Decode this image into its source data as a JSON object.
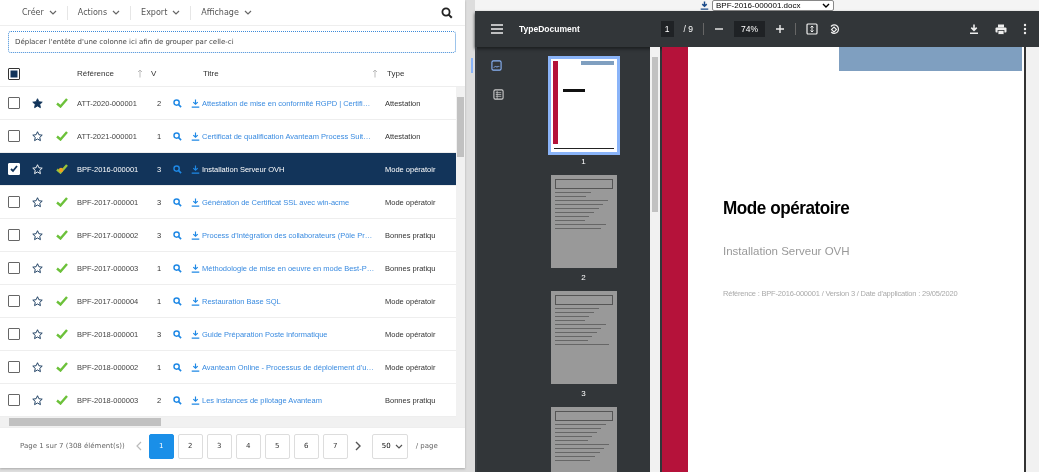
{
  "toolbar": {
    "menus": [
      {
        "label": "Créer"
      },
      {
        "label": "Actions"
      },
      {
        "label": "Export"
      },
      {
        "label": "Affichage"
      }
    ]
  },
  "group_panel": {
    "hint": "Déplacer l'entête d'une colonne ici afin de grouper par celle-ci"
  },
  "table": {
    "header_checkbox": {
      "indeterminate": true
    },
    "columns": [
      {
        "label": "Référence",
        "sort_icon": true
      },
      {
        "label": "V",
        "sort_icon": false
      },
      {
        "label": "Titre",
        "sort_icon": true
      },
      {
        "label": "Type",
        "sort_icon": false
      }
    ],
    "rows": [
      {
        "selected": false,
        "starred": true,
        "kind": "valid",
        "reference": "ATT-2020-000001",
        "version": "2",
        "title": "Attestation de mise en conformité RGPD | Certifi…",
        "type": "Attestation"
      },
      {
        "selected": false,
        "starred": false,
        "kind": "valid",
        "reference": "ATT-2021-000001",
        "version": "1",
        "title": "Certificat de qualification Avanteam Process Suit…",
        "type": "Attestation"
      },
      {
        "selected": true,
        "starred": false,
        "kind": "draft",
        "reference": "BPF-2016-000001",
        "version": "3",
        "title": "Installation Serveur OVH",
        "type": "Mode opératoir"
      },
      {
        "selected": false,
        "starred": false,
        "kind": "valid",
        "reference": "BPF-2017-000001",
        "version": "3",
        "title": "Génération de Certificat SSL avec win-acme",
        "type": "Mode opératoir"
      },
      {
        "selected": false,
        "starred": false,
        "kind": "valid",
        "reference": "BPF-2017-000002",
        "version": "3",
        "title": "Process d'Intégration des collaborateurs (Pôle Pr…",
        "type": "Bonnes pratiqu"
      },
      {
        "selected": false,
        "starred": false,
        "kind": "valid",
        "reference": "BPF-2017-000003",
        "version": "1",
        "title": "Méthodologie de mise en oeuvre en mode Best-P…",
        "type": "Bonnes pratiqu"
      },
      {
        "selected": false,
        "starred": false,
        "kind": "valid",
        "reference": "BPF-2017-000004",
        "version": "1",
        "title": "Restauration Base SQL",
        "type": "Mode opératoir"
      },
      {
        "selected": false,
        "starred": false,
        "kind": "valid",
        "reference": "BPF-2018-000001",
        "version": "3",
        "title": "Guide Préparation Poste informatique",
        "type": "Mode opératoir"
      },
      {
        "selected": false,
        "starred": false,
        "kind": "valid",
        "reference": "BPF-2018-000002",
        "version": "1",
        "title": "Avanteam Online - Processus de déploiement d'u…",
        "type": "Mode opératoir"
      },
      {
        "selected": false,
        "starred": false,
        "kind": "valid",
        "reference": "BPF-2018-000003",
        "version": "2",
        "title": "Les instances de pilotage Avanteam",
        "type": "Bonnes pratiqu"
      }
    ]
  },
  "pagination": {
    "summary": "Page 1 sur 7 (308 élément(s))",
    "pages": [
      {
        "label": "1",
        "selected": true
      },
      {
        "label": "2",
        "selected": false
      },
      {
        "label": "3",
        "selected": false
      },
      {
        "label": "4",
        "selected": false
      },
      {
        "label": "5",
        "selected": false
      },
      {
        "label": "6",
        "selected": false
      },
      {
        "label": "7",
        "selected": false
      }
    ],
    "page_size": "50",
    "page_size_suffix": "/ page"
  },
  "viewer": {
    "file_select": "BPF-2016-000001.docx",
    "title": "TypeDocument",
    "page": "1",
    "page_count": "/ 9",
    "zoom": "74%",
    "sidebar_views": [
      {
        "kind": "thumbnails",
        "selected": true
      },
      {
        "kind": "outline",
        "selected": false
      }
    ],
    "thumbnails": [
      {
        "kind": "cover",
        "label": "1",
        "selected": true
      },
      {
        "kind": "text",
        "label": "2",
        "selected": false
      },
      {
        "kind": "text",
        "label": "3",
        "selected": false
      },
      {
        "kind": "text",
        "selected": false
      }
    ],
    "document": {
      "heading": "Mode opératoire",
      "subtitle": "Installation Serveur OVH",
      "reference_line": "Référence : BPF-2016-000001 / Version 3 / Date d'application : 29/05/2020"
    }
  }
}
